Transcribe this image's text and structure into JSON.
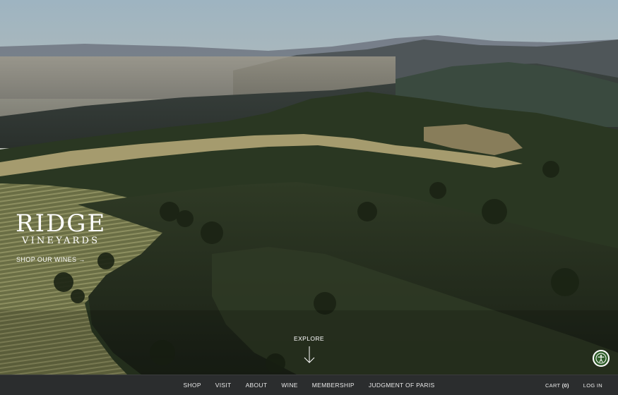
{
  "hero": {
    "brand_main": "RIDGE",
    "brand_sub": "VINEYARDS",
    "shop_link": "SHOP OUR WINES →",
    "explore_label": "EXPLORE"
  },
  "nav": {
    "items": [
      {
        "label": "SHOP"
      },
      {
        "label": "VISIT"
      },
      {
        "label": "ABOUT"
      },
      {
        "label": "WINE"
      },
      {
        "label": "MEMBERSHIP"
      },
      {
        "label": "JUDGMENT OF PARIS"
      }
    ],
    "cart_label": "CART",
    "cart_count": "(0)",
    "login_label": "LOG IN"
  },
  "colors": {
    "nav_bg": "#2b2d2e",
    "accessibility_green": "#2f5d2a"
  },
  "icons": {
    "explore": "arrow-down-icon",
    "accessibility": "accessibility-icon"
  }
}
